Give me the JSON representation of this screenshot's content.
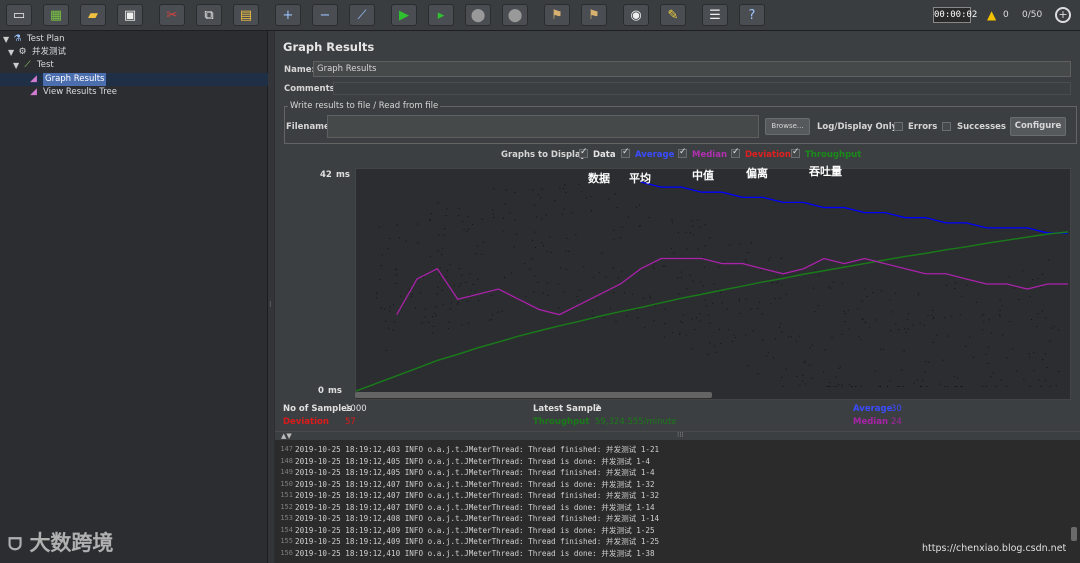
{
  "toolbar": {
    "buttons": [
      {
        "name": "new-button",
        "icon": "new-file-icon"
      },
      {
        "name": "templates-button",
        "icon": "templates-icon"
      },
      {
        "name": "open-button",
        "icon": "open-folder-icon"
      },
      {
        "name": "save-button",
        "icon": "save-icon"
      },
      {
        "name": "cut-button",
        "icon": "cut-icon"
      },
      {
        "name": "copy-button",
        "icon": "copy-icon"
      },
      {
        "name": "paste-button",
        "icon": "paste-icon"
      },
      {
        "name": "expand-button",
        "icon": "plus-icon"
      },
      {
        "name": "collapse-button",
        "icon": "minus-icon"
      },
      {
        "name": "toggle-button",
        "icon": "toggle-icon"
      },
      {
        "name": "start-button",
        "icon": "play-icon"
      },
      {
        "name": "start-no-pauses-button",
        "icon": "play-no-pause-icon"
      },
      {
        "name": "stop-button",
        "icon": "stop-icon"
      },
      {
        "name": "shutdown-button",
        "icon": "shutdown-icon"
      },
      {
        "name": "clear-button",
        "icon": "broom-icon"
      },
      {
        "name": "clear-all-button",
        "icon": "broom-all-icon"
      },
      {
        "name": "search-button",
        "icon": "binoculars-icon"
      },
      {
        "name": "reset-search-button",
        "icon": "reset-search-icon"
      },
      {
        "name": "function-helper-button",
        "icon": "list-icon"
      },
      {
        "name": "help-button",
        "icon": "help-icon"
      }
    ],
    "timer": "00:00:02",
    "warning_count": "0",
    "threads": "0/50"
  },
  "tree": {
    "items": [
      {
        "label": "Test Plan",
        "icon": "test-plan-icon"
      },
      {
        "label": "并发测试",
        "icon": "thread-group-icon"
      },
      {
        "label": "Test",
        "icon": "sampler-icon"
      },
      {
        "label": "Graph Results",
        "icon": "graph-icon"
      },
      {
        "label": "View Results Tree",
        "icon": "graph-icon"
      }
    ]
  },
  "panel": {
    "title": "Graph Results",
    "name_label": "Name:",
    "name_value": "Graph Results",
    "comments_label": "Comments:",
    "comments_value": "",
    "write_legend": "Write results to file / Read from file",
    "filename_label": "Filename",
    "filename_value": "",
    "browse_label": "Browse...",
    "log_display_label": "Log/Display Only:",
    "errors_label": "Errors",
    "successes_label": "Successes",
    "configure_label": "Configure",
    "graphs_to_display_label": "Graphs to Display",
    "graphs": {
      "data": "Data",
      "average": "Average",
      "median": "Median",
      "deviation": "Deviation",
      "throughput": "Throughput"
    }
  },
  "colors": {
    "data": "#000000",
    "average": "#0000ff",
    "median": "#aa22aa",
    "deviation": "#dd0000",
    "throughput": "#1a7a1a"
  },
  "chart_data": {
    "type": "line",
    "ylabel": "ms",
    "y_ticks": [
      "42",
      "0"
    ],
    "ylim": [
      0,
      42
    ],
    "series": [
      {
        "name": "Average",
        "values": [
          null,
          null,
          null,
          null,
          null,
          null,
          null,
          null,
          null,
          null,
          null,
          null,
          null,
          null,
          41,
          40,
          40,
          39,
          39,
          38,
          38,
          37,
          37,
          36,
          36,
          35,
          35,
          34,
          34,
          33,
          33,
          32,
          32,
          32,
          31,
          31
        ]
      },
      {
        "name": "Throughput",
        "values": [
          0,
          1.5,
          3,
          4.5,
          6,
          7.2,
          8.5,
          9.6,
          10.8,
          11.8,
          12.8,
          13.7,
          14.7,
          15.6,
          16.4,
          17.3,
          18.2,
          19,
          19.8,
          20.6,
          21.4,
          22.1,
          22.9,
          23.6,
          24.3,
          25,
          25.7,
          26.4,
          27,
          27.7,
          28.3,
          29,
          29.6,
          30.2,
          30.8,
          31.2
        ]
      },
      {
        "name": "Median",
        "values": [
          null,
          null,
          15,
          22,
          24,
          18,
          19,
          20,
          18,
          16,
          15,
          17,
          19,
          21,
          24,
          26,
          26,
          26,
          25,
          25,
          24,
          23,
          24,
          26,
          25,
          26,
          25,
          24,
          23,
          23,
          22,
          21,
          21,
          20,
          21,
          21
        ]
      }
    ]
  },
  "stats": {
    "samples_label": "No of Samples",
    "samples_value": "1000",
    "latest_label": "Latest Sample",
    "latest_value": "2",
    "average_label": "Average",
    "average_value": "30",
    "deviation_label": "Deviation",
    "deviation_value": "57",
    "throughput_label": "Throughput",
    "throughput_value": "59,324.555/minute",
    "median_label": "Median",
    "median_value": "24"
  },
  "annotations": {
    "data": "数据",
    "average": "平均",
    "median": "中值",
    "deviation": "偏离",
    "throughput": "吞吐量"
  },
  "console": {
    "lines": [
      {
        "n": "147",
        "text": "2019-10-25 18:19:12,403 INFO o.a.j.t.JMeterThread: Thread finished: 并发测试 1-21"
      },
      {
        "n": "148",
        "text": "2019-10-25 18:19:12,405 INFO o.a.j.t.JMeterThread: Thread is done: 并发测试 1-4"
      },
      {
        "n": "149",
        "text": "2019-10-25 18:19:12,405 INFO o.a.j.t.JMeterThread: Thread finished: 并发测试 1-4"
      },
      {
        "n": "150",
        "text": "2019-10-25 18:19:12,407 INFO o.a.j.t.JMeterThread: Thread is done: 并发测试 1-32"
      },
      {
        "n": "151",
        "text": "2019-10-25 18:19:12,407 INFO o.a.j.t.JMeterThread: Thread finished: 并发测试 1-32"
      },
      {
        "n": "152",
        "text": "2019-10-25 18:19:12,407 INFO o.a.j.t.JMeterThread: Thread is done: 并发测试 1-14"
      },
      {
        "n": "153",
        "text": "2019-10-25 18:19:12,408 INFO o.a.j.t.JMeterThread: Thread finished: 并发测试 1-14"
      },
      {
        "n": "154",
        "text": "2019-10-25 18:19:12,409 INFO o.a.j.t.JMeterThread: Thread is done: 并发测试 1-25"
      },
      {
        "n": "155",
        "text": "2019-10-25 18:19:12,409 INFO o.a.j.t.JMeterThread: Thread finished: 并发测试 1-25"
      },
      {
        "n": "156",
        "text": "2019-10-25 18:19:12,410 INFO o.a.j.t.JMeterThread: Thread is done: 并发测试 1-38"
      }
    ]
  },
  "watermark": {
    "logo": "大数跨境",
    "url": "https://chenxiao.blog.csdn.net"
  }
}
